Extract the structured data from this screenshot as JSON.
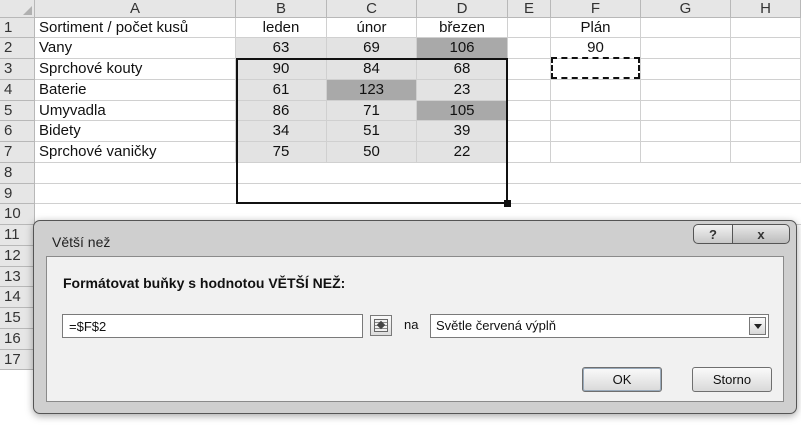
{
  "columns": [
    "A",
    "B",
    "C",
    "D",
    "E",
    "F",
    "G",
    "H"
  ],
  "rows": [
    "1",
    "2",
    "3",
    "4",
    "5",
    "6",
    "7",
    "8",
    "9",
    "10",
    "11",
    "12",
    "13",
    "14",
    "15",
    "16",
    "17"
  ],
  "header_row": {
    "a": "Sortiment / počet kusů",
    "b": "leden",
    "c": "únor",
    "d": "březen",
    "f": "Plán"
  },
  "data": [
    {
      "name": "Vany",
      "b": "63",
      "c": "69",
      "d": "106"
    },
    {
      "name": "Sprchové kouty",
      "b": "90",
      "c": "84",
      "d": "68"
    },
    {
      "name": "Baterie",
      "b": "61",
      "c": "123",
      "d": "23"
    },
    {
      "name": "Umyvadla",
      "b": "86",
      "c": "71",
      "d": "105"
    },
    {
      "name": "Bidety",
      "b": "34",
      "c": "51",
      "d": "39"
    },
    {
      "name": "Sprchové vaničky",
      "b": "75",
      "c": "50",
      "d": "22"
    }
  ],
  "plan_value": "90",
  "colors": {
    "highlight_dark": "#a9a9a9",
    "highlight_light": "#e3e3e3"
  },
  "dialog": {
    "title": "Větší než",
    "help": "?",
    "close": "x",
    "heading": "Formátovat buňky s hodnotou VĚTŠÍ NEŽ:",
    "value": "=$F$2",
    "connector": "na",
    "format_option": "Světle červená výplň",
    "ok": "OK",
    "cancel": "Storno"
  }
}
